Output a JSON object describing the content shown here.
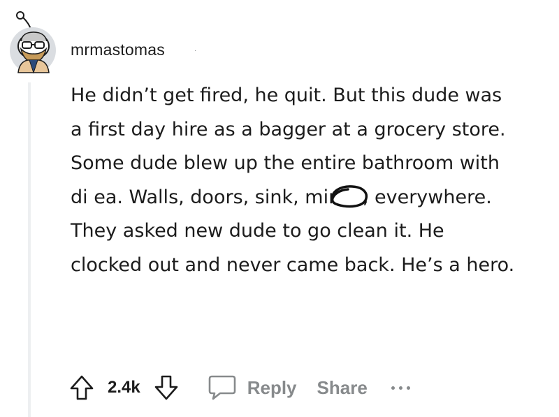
{
  "comment": {
    "author": "mrmastomas",
    "separator": "·",
    "body": "He didn’t get fired, he quit. But this dude was a first day hire as a bagger at a grocery store. Some dude blew up the entire bathroom with di   ea. Walls, doors, sink, mirror, everywhere. They asked new dude to go clean it. He clocked out and never came back. He’s a hero.",
    "avatar_icon": "snoo-avatar-icon",
    "censor_mark": "scribble-circle-icon"
  },
  "actions": {
    "score": "2.4k",
    "reply_label": "Reply",
    "share_label": "Share",
    "upvote_icon": "arrow-up-icon",
    "downvote_icon": "arrow-down-icon",
    "reply_icon": "chat-bubble-icon",
    "more_icon": "ellipsis-icon"
  },
  "colors": {
    "text": "#1c1c1c",
    "muted": "#878a8c",
    "thread_line": "#edeff1"
  }
}
